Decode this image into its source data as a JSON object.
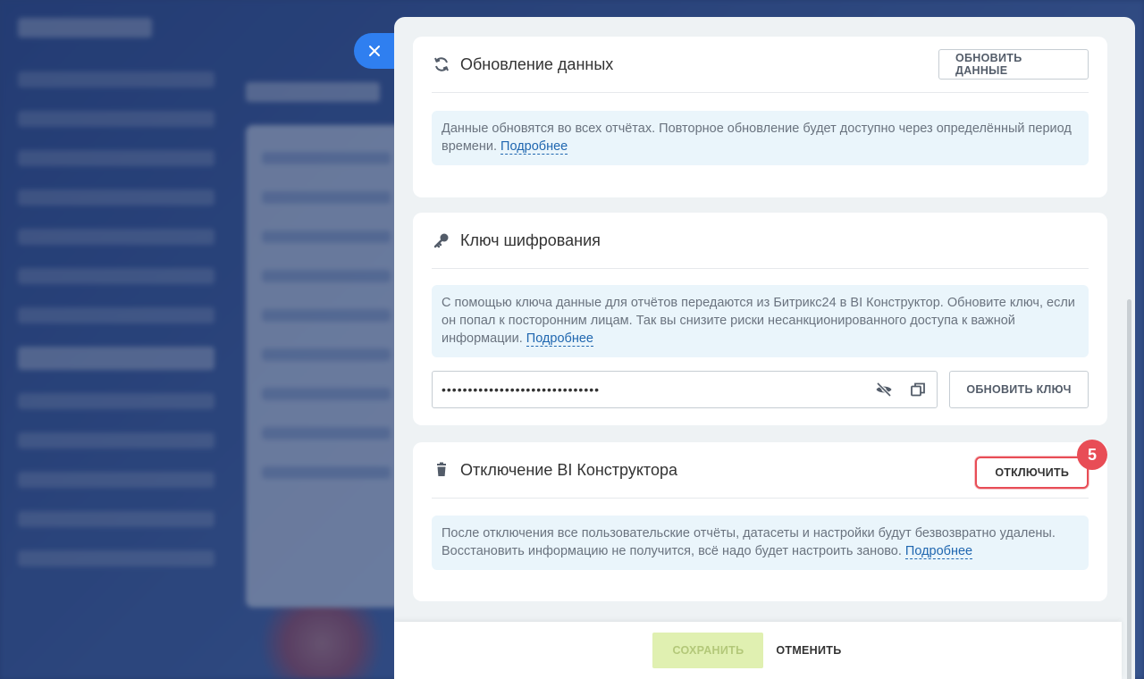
{
  "refresh": {
    "title": "Обновление данных",
    "button": "ОБНОВИТЬ ДАННЫЕ",
    "info_text": "Данные обновятся во всех отчётах. Повторное обновление будет доступно через определённый период времени. ",
    "info_link": "Подробнее"
  },
  "encryption": {
    "title": "Ключ шифрования",
    "info_text": "С помощью ключа данные для отчётов передаются из Битрикс24 в BI Конструктор. Обновите ключ, если он попал к посторонним лицам. Так вы снизите риски несанкционированного доступа к важной информации. ",
    "info_link": "Подробнее",
    "key_value": "••••••••••••••••••••••••••••••",
    "button": "ОБНОВИТЬ КЛЮЧ"
  },
  "disable": {
    "title": "Отключение BI Конструктора",
    "button": "ОТКЛЮЧИТЬ",
    "step_badge": "5",
    "info_text": "После отключения все пользовательские отчёты, датасеты и настройки будут безвозвратно удалены. Восстановить информацию не получится, всё надо будет настроить заново. ",
    "info_link": "Подробнее"
  },
  "footer": {
    "save": "СОХРАНИТЬ",
    "cancel": "ОТМЕНИТЬ"
  },
  "colors": {
    "accent_blue": "#2f7ff0",
    "highlight_red": "#e84d56",
    "info_bg": "#eaf5fb",
    "save_disabled": "#e0f0b1"
  }
}
